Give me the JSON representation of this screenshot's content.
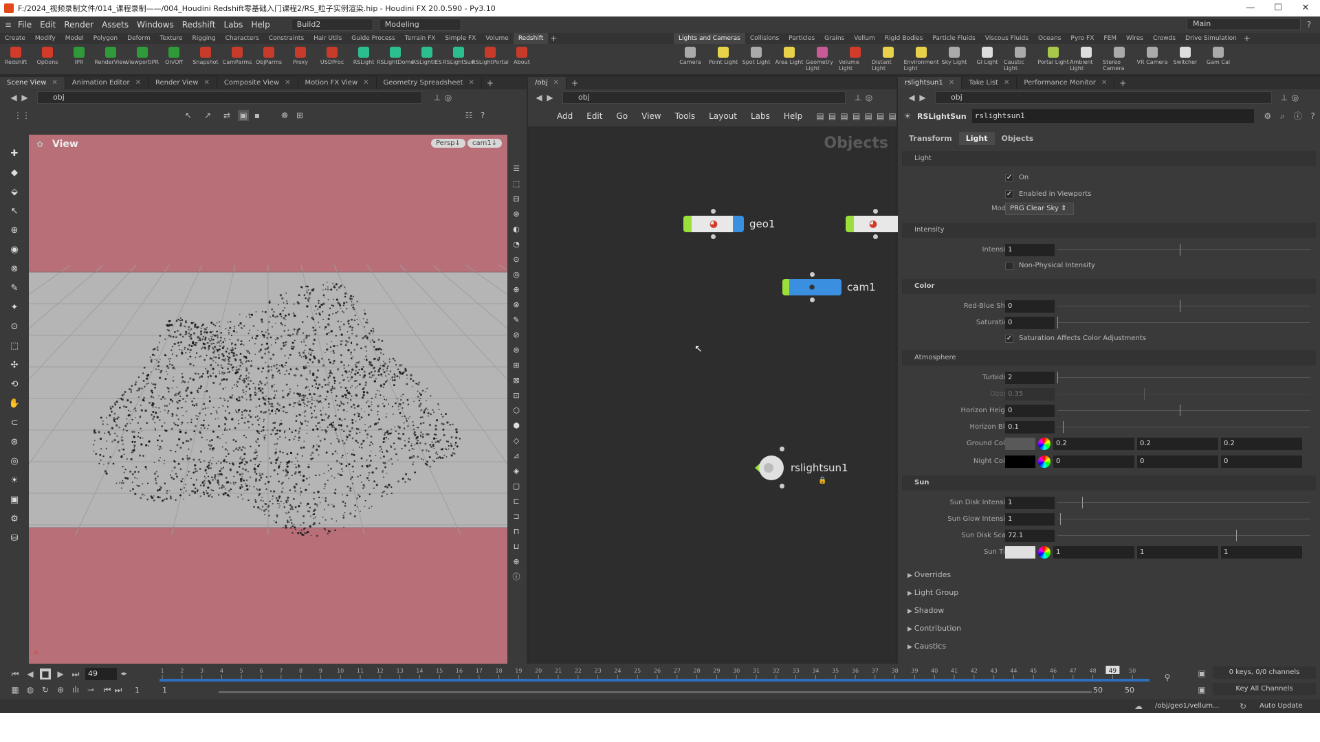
{
  "window": {
    "title": "F:/2024_视频录制文件/014_课程录制——/004_Houdini Redshift零基础入门课程2/RS_粒子实例渲染.hip - Houdini FX 20.0.590 - Py3.10",
    "min": "—",
    "max": "☐",
    "close": "✕"
  },
  "menu": {
    "items": [
      "File",
      "Edit",
      "Render",
      "Assets",
      "Windows",
      "Redshift",
      "Labs",
      "Help"
    ],
    "build": "Build2",
    "desktop": "Modeling",
    "main": "Main"
  },
  "shelf_left": {
    "tabs": [
      "Create",
      "Modify",
      "Model",
      "Polygon",
      "Deform",
      "Texture",
      "Rigging",
      "Characters",
      "Constraints",
      "Hair Utils",
      "Guide Process",
      "Terrain FX",
      "Simple FX",
      "Volume",
      "Redshift"
    ],
    "active": "Redshift",
    "tools": [
      {
        "label": "Redshift",
        "color": "#d23a2a"
      },
      {
        "label": "Options",
        "color": "#d23a2a"
      },
      {
        "label": "IPR",
        "color": "#2e9a3a"
      },
      {
        "label": "RenderView",
        "color": "#2e9a3a"
      },
      {
        "label": "ViewportIPR",
        "color": "#2e9a3a"
      },
      {
        "label": "On/Off",
        "color": "#2e9a3a"
      },
      {
        "label": "Snapshot",
        "color": "#c83a2a"
      },
      {
        "label": "CamParms",
        "color": "#c83a2a"
      },
      {
        "label": "ObjParms",
        "color": "#c83a2a"
      },
      {
        "label": "Proxy",
        "color": "#c83a2a"
      },
      {
        "label": "USDProc",
        "color": "#c83a2a"
      },
      {
        "label": "RSLight",
        "color": "#2bbf8f"
      },
      {
        "label": "RSLightDome",
        "color": "#2bbf8f"
      },
      {
        "label": "RSLightIES",
        "color": "#2bbf8f"
      },
      {
        "label": "RSLightSun",
        "color": "#2bbf8f"
      },
      {
        "label": "RSLightPortal",
        "color": "#c83a2a"
      },
      {
        "label": "About",
        "color": "#c83a2a"
      }
    ]
  },
  "shelf_right": {
    "tabs": [
      "Lights and Cameras",
      "Collisions",
      "Particles",
      "Grains",
      "Vellum",
      "Rigid Bodies",
      "Particle Fluids",
      "Viscous Fluids",
      "Oceans",
      "Pyro FX",
      "FEM",
      "Wires",
      "Crowds",
      "Drive Simulation"
    ],
    "active": "Lights and Cameras",
    "tools": [
      {
        "label": "Camera",
        "color": "#aaa"
      },
      {
        "label": "Point Light",
        "color": "#e8d24a"
      },
      {
        "label": "Spot Light",
        "color": "#aaa"
      },
      {
        "label": "Area Light",
        "color": "#e8d24a"
      },
      {
        "label": "Geometry Light",
        "color": "#c85a9a"
      },
      {
        "label": "Volume Light",
        "color": "#d23a2a"
      },
      {
        "label": "Distant Light",
        "color": "#e8d24a"
      },
      {
        "label": "Environment Light",
        "color": "#e8d24a"
      },
      {
        "label": "Sky Light",
        "color": "#aaa"
      },
      {
        "label": "GI Light",
        "color": "#ddd"
      },
      {
        "label": "Caustic Light",
        "color": "#aaa"
      },
      {
        "label": "Portal Light",
        "color": "#a8c84a"
      },
      {
        "label": "Ambient Light",
        "color": "#ddd"
      },
      {
        "label": "Stereo Camera",
        "color": "#aaa"
      },
      {
        "label": "VR Camera",
        "color": "#aaa"
      },
      {
        "label": "Switcher",
        "color": "#ddd"
      },
      {
        "label": "Gam Cal",
        "color": "#aaa"
      }
    ]
  },
  "left_pane": {
    "tabs": [
      "Scene View",
      "Animation Editor",
      "Render View",
      "Composite View",
      "Motion FX View",
      "Geometry Spreadsheet"
    ],
    "path": "obj",
    "view_label": "View",
    "persp": "Persp↓",
    "cam": "cam1↓"
  },
  "mid_pane": {
    "tab": "/obj",
    "path": "obj",
    "menus": [
      "Add",
      "Edit",
      "Go",
      "View",
      "Tools",
      "Layout",
      "Labs",
      "Help"
    ],
    "context_label": "Objects",
    "nodes": [
      {
        "name": "geo1"
      },
      {
        "name": "cam1"
      },
      {
        "name": "rslightsun1"
      }
    ]
  },
  "right_pane": {
    "tabs": [
      "rslightsun1",
      "Take List",
      "Performance Monitor"
    ],
    "path": "obj",
    "node_type": "RSLightSun",
    "node_name": "rslightsun1",
    "parm_tabs": [
      "Transform",
      "Light",
      "Objects"
    ],
    "active_parm_tab": "Light",
    "sections": {
      "light": "Light",
      "intensity": "Intensity",
      "color": "Color",
      "atmosphere": "Atmosphere",
      "sun": "Sun"
    },
    "on_label": "On",
    "enabled_viewports_label": "Enabled in Viewports",
    "model_label": "Model",
    "model_value": "PRG Clear Sky",
    "intensity_label": "Intensity",
    "intensity_value": "1",
    "nonphys_label": "Non-Physical Intensity",
    "redblue_label": "Red-Blue Shift",
    "redblue_value": "0",
    "saturation_label": "Saturation",
    "saturation_value": "0",
    "sat_affects_label": "Saturation Affects Color Adjustments",
    "turbidity_label": "Turbidity",
    "turbidity_value": "2",
    "ozone_label": "Ozone",
    "ozone_value": "0.35",
    "horizon_height_label": "Horizon Height",
    "horizon_height_value": "0",
    "horizon_blur_label": "Horizon Blur",
    "horizon_blur_value": "0.1",
    "ground_color_label": "Ground Color",
    "ground_color": [
      "0.2",
      "0.2",
      "0.2"
    ],
    "night_color_label": "Night Color",
    "night_color": [
      "0",
      "0",
      "0"
    ],
    "sun_disk_intensity_label": "Sun Disk Intensity",
    "sun_disk_intensity_value": "1",
    "sun_glow_label": "Sun Glow Intensity",
    "sun_glow_value": "1",
    "sun_disk_scale_label": "Sun Disk Scale",
    "sun_disk_scale_value": "72.1",
    "sun_tint_label": "Sun Tint",
    "sun_tint": [
      "1",
      "1",
      "1"
    ],
    "folders": [
      "Overrides",
      "Light Group",
      "Shadow",
      "Contribution",
      "Caustics"
    ]
  },
  "timeline": {
    "frame": "49",
    "ticks": [
      "1",
      "2",
      "3",
      "4",
      "5",
      "6",
      "7",
      "8",
      "9",
      "10",
      "11",
      "12",
      "13",
      "14",
      "15",
      "16",
      "17",
      "18",
      "19",
      "20",
      "21",
      "22",
      "23",
      "24",
      "25",
      "26",
      "27",
      "28",
      "29",
      "30",
      "31",
      "32",
      "33",
      "34",
      "35",
      "36",
      "37",
      "38",
      "39",
      "40",
      "41",
      "42",
      "43",
      "44",
      "45",
      "46",
      "47",
      "48",
      "49",
      "50"
    ],
    "current": 49,
    "total": 50,
    "start": "1",
    "start2": "1",
    "end": "50",
    "end2": "50",
    "keys": "0 keys, 0/0 channels",
    "key_all": "Key All Channels"
  },
  "status": {
    "path": "/obj/geo1/vellum...",
    "auto_update": "Auto Update"
  },
  "colors": {
    "viewport_bg": "#b86f78",
    "grid_floor": "#b9b9b9",
    "node_green": "#9be03a",
    "node_blue": "#3a8fe0"
  }
}
